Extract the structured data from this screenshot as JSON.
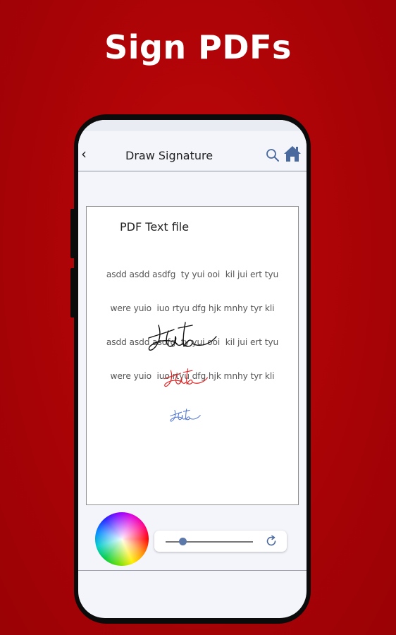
{
  "headline": "Sign PDFs",
  "appbar": {
    "title": "Draw Signature",
    "back_icon": "back-chevron-icon",
    "search_icon": "search-icon",
    "home_icon": "home-icon"
  },
  "document": {
    "title": "PDF Text file",
    "lines": [
      "asdd asdd asdfg  ty yui ooi  kil jui ert tyu",
      "were yuio  iuo rtyu dfg hjk mnhy tyr kli",
      "asdd asdd asdfg  ty yui ooi  kil jui ert tyu",
      "were yuio  iuo rtyu dfg hjk mnhy tyr kli"
    ],
    "signatures": [
      {
        "color": "#111111"
      },
      {
        "color": "#e02424"
      },
      {
        "color": "#4a6fd0"
      }
    ]
  },
  "tools": {
    "color_wheel_icon": "color-wheel-icon",
    "stroke_width_fraction": 0.2,
    "reset_icon": "refresh-icon"
  },
  "colors": {
    "background": "#b00306",
    "accent": "#5b78a8",
    "home_icon": "#4a6a9e"
  }
}
